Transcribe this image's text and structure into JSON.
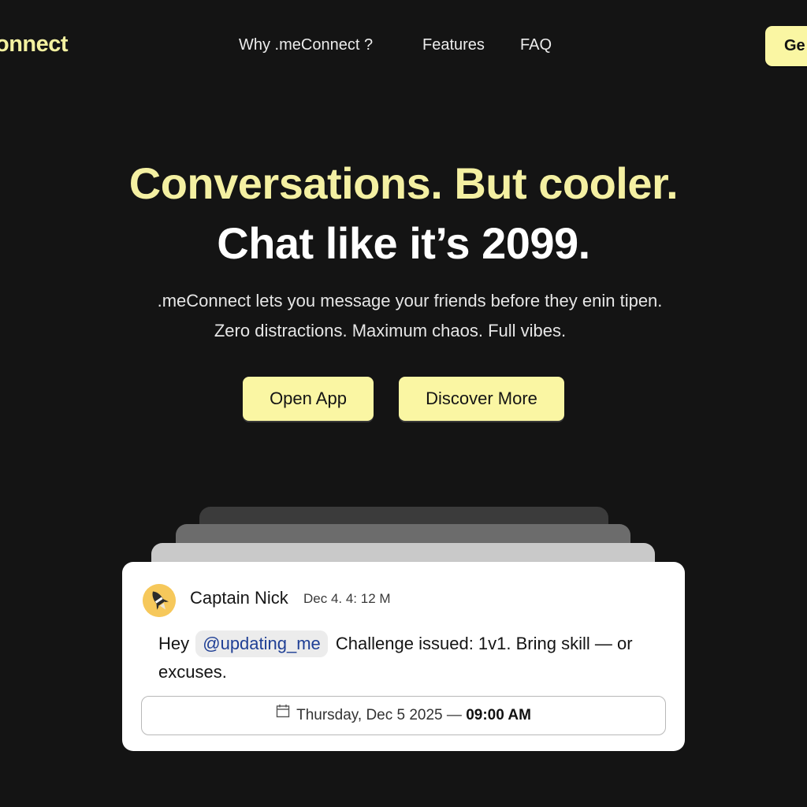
{
  "brand": {
    "name": ".meConnect",
    "visible_fragment": "onnect",
    "accent_color": "#faf6a3"
  },
  "nav": {
    "items": [
      {
        "label": "Why .meConnect ?"
      },
      {
        "label": "Features"
      },
      {
        "label": "FAQ"
      }
    ],
    "cta_label": "Ge"
  },
  "hero": {
    "title_line1": "Conversations. But cooler.",
    "title_line2": "Chat like it’s 2099.",
    "subtitle_line1": ".meConnect lets you message your friends before they enin tipen.",
    "subtitle_line2": "Zero distractions. Maximum chaos. Full vibes.",
    "buttons": {
      "open_app": "Open App",
      "discover_more": "Discover More"
    }
  },
  "message_card": {
    "avatar_icon": "rocket-avatar-icon",
    "author": "Captain Nick",
    "timestamp": "Dec 4. 4: 12 M",
    "text_before_mention": "Hey",
    "mention": "@updating_me",
    "text_after_mention": "Challenge issued: 1v1. Bring skill — or excuses.",
    "event": {
      "icon": "calendar-icon",
      "date": "Thursday, Dec 5 2025",
      "separator": "—",
      "time": "09:00 AM"
    }
  }
}
